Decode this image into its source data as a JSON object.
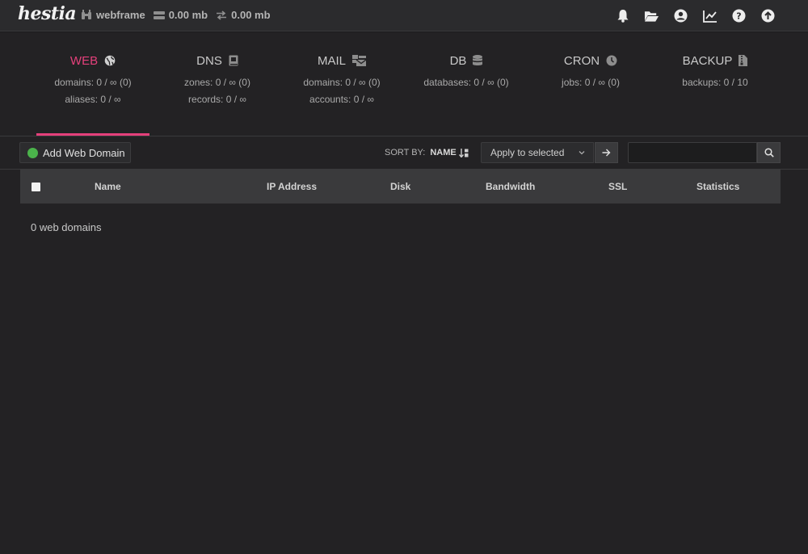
{
  "topbar": {
    "logo": "hestia",
    "user": "webframe",
    "disk_usage": "0.00 mb",
    "bandwidth_usage": "0.00 mb",
    "icons": [
      "bell-icon",
      "folder-open-icon",
      "user-circle-icon",
      "chart-line-icon",
      "help-icon",
      "upload-icon"
    ]
  },
  "stats": [
    {
      "title": "WEB",
      "icon": "globe-icon",
      "active": true,
      "lines": [
        "domains: 0 / ∞ (0)",
        "aliases: 0 / ∞"
      ]
    },
    {
      "title": "DNS",
      "icon": "book-icon",
      "active": false,
      "lines": [
        "zones: 0 / ∞ (0)",
        "records: 0 / ∞"
      ]
    },
    {
      "title": "MAIL",
      "icon": "mail-bulk-icon",
      "active": false,
      "lines": [
        "domains: 0 / ∞ (0)",
        "accounts: 0 / ∞"
      ]
    },
    {
      "title": "DB",
      "icon": "database-icon",
      "active": false,
      "lines": [
        "databases: 0 / ∞ (0)"
      ]
    },
    {
      "title": "CRON",
      "icon": "clock-icon",
      "active": false,
      "lines": [
        "jobs: 0 / ∞ (0)"
      ]
    },
    {
      "title": "BACKUP",
      "icon": "file-archive-icon",
      "active": false,
      "lines": [
        "backups: 0 / 10"
      ]
    }
  ],
  "toolbar": {
    "add_label": "Add Web Domain",
    "sort_label": "SORT BY:",
    "sort_value": "NAME",
    "bulk_action": "Apply to selected",
    "search_placeholder": ""
  },
  "table": {
    "columns": [
      "Name",
      "IP Address",
      "Disk",
      "Bandwidth",
      "SSL",
      "Statistics"
    ],
    "empty_text": "0 web domains"
  },
  "colors": {
    "accent": "#e5407b",
    "background": "#232224",
    "add_icon": "#4bb34b"
  }
}
